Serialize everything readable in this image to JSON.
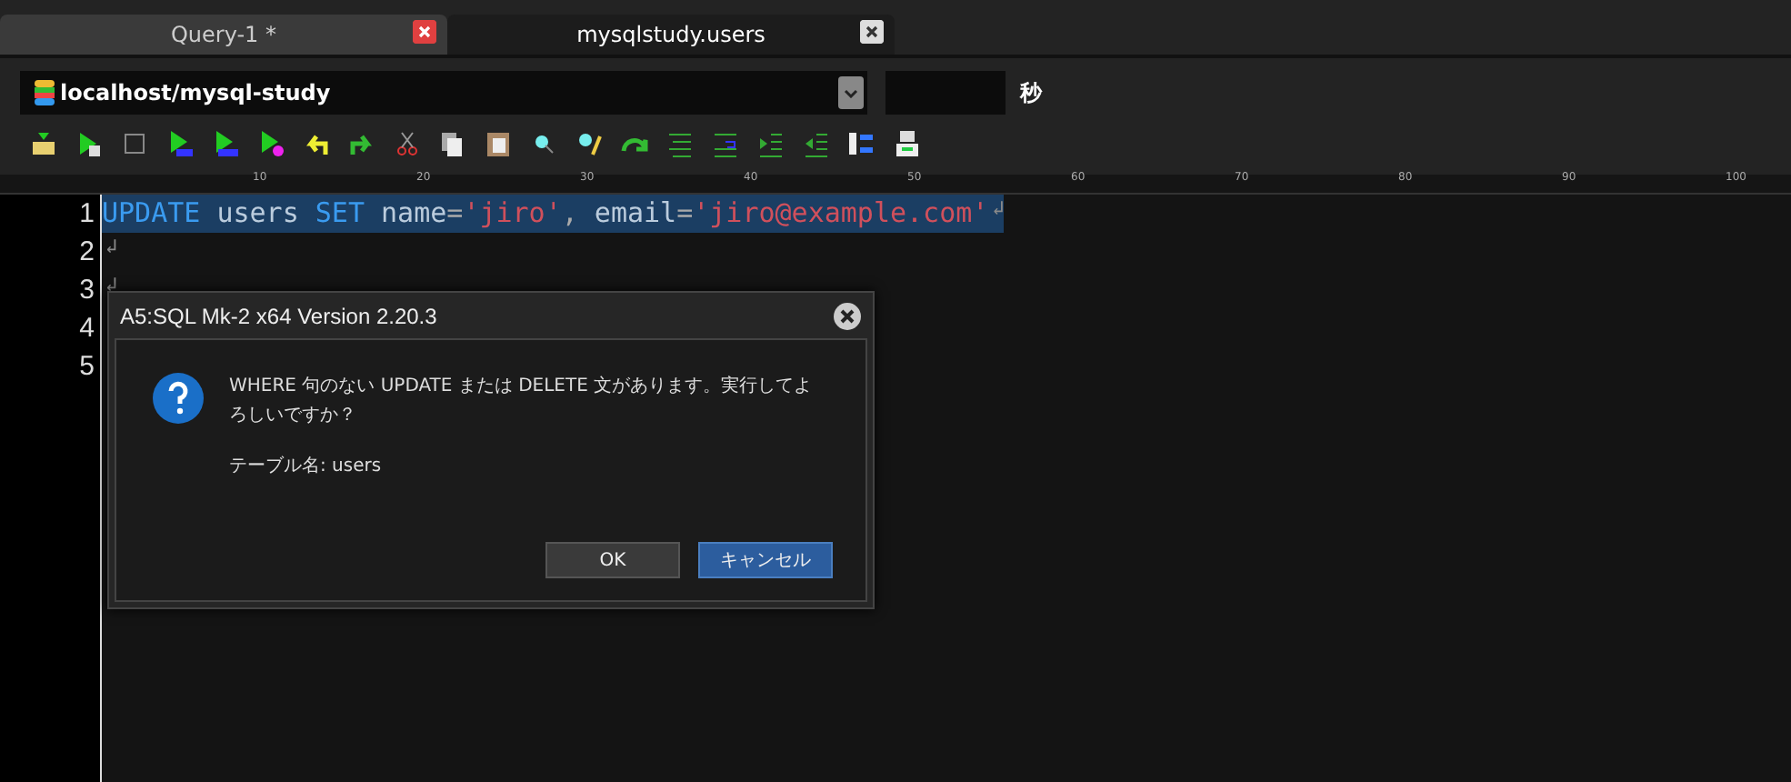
{
  "tabs": [
    {
      "label": "Query-1 *",
      "selected": false
    },
    {
      "label": "mysqlstudy.users",
      "selected": true
    }
  ],
  "connection": {
    "value": "localhost/mysql-study"
  },
  "timeout": {
    "unit": "秒"
  },
  "ruler": [
    "10",
    "20",
    "30",
    "40",
    "50",
    "60",
    "70",
    "80",
    "90",
    "100"
  ],
  "editor": {
    "lines": [
      {
        "number": "1",
        "selected": true,
        "end_mark": "↲",
        "tokens": [
          {
            "kind": "keyword",
            "text": "UPDATE"
          },
          {
            "kind": "plain",
            "text": " users "
          },
          {
            "kind": "keyword",
            "text": "SET"
          },
          {
            "kind": "plain",
            "text": " name"
          },
          {
            "kind": "op",
            "text": "="
          },
          {
            "kind": "string",
            "text": "'jiro'"
          },
          {
            "kind": "op",
            "text": ","
          },
          {
            "kind": "plain",
            "text": " email"
          },
          {
            "kind": "op",
            "text": "="
          },
          {
            "kind": "string",
            "text": "'jiro@example.com'"
          }
        ]
      },
      {
        "number": "2",
        "selected": false,
        "end_mark": "↲"
      },
      {
        "number": "3",
        "selected": false,
        "end_mark": "↲"
      },
      {
        "number": "4",
        "selected": false
      },
      {
        "number": "5",
        "selected": false
      }
    ]
  },
  "dialog": {
    "title": "A5:SQL Mk-2 x64 Version 2.20.3",
    "message": "WHERE 句のない UPDATE または DELETE 文があります。実行してよろしいですか？",
    "detail": "テーブル名: users",
    "buttons": [
      {
        "label": "OK",
        "primary": false
      },
      {
        "label": "キャンセル",
        "primary": true
      }
    ]
  }
}
